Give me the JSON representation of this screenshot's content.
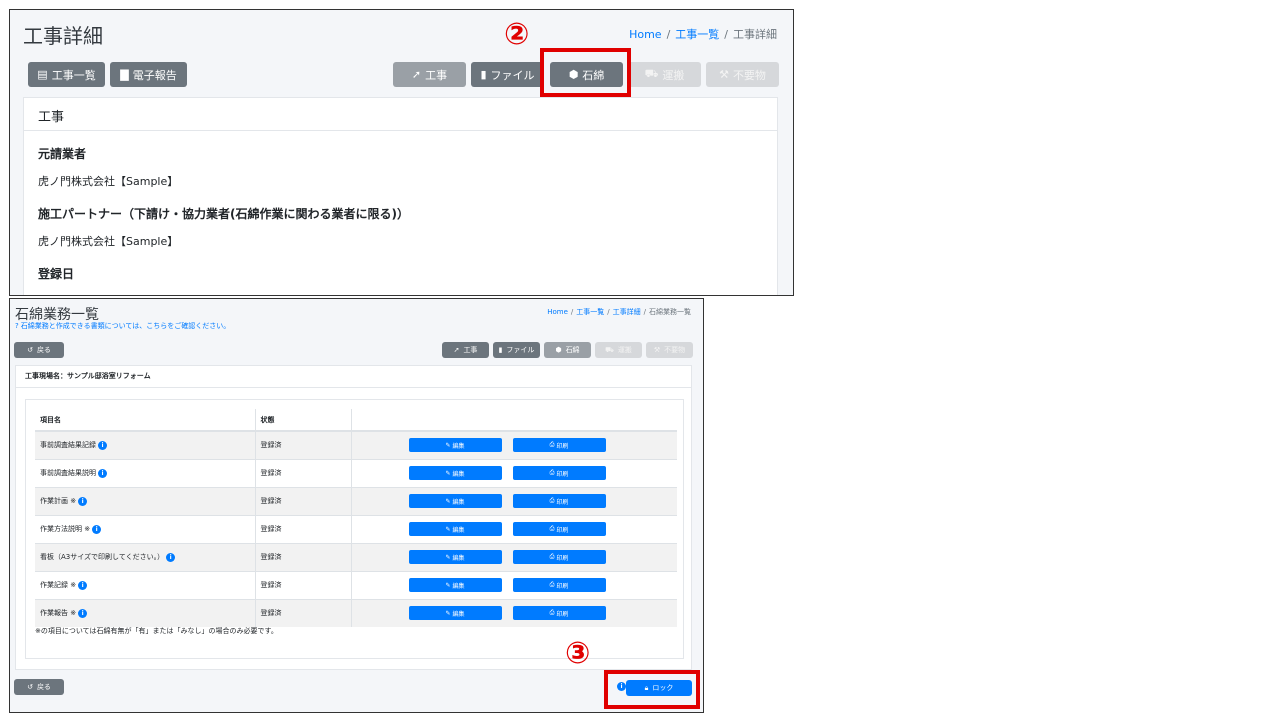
{
  "panel1": {
    "title": "工事詳細",
    "breadcrumb": {
      "home": "Home",
      "list": "工事一覧",
      "current": "工事詳細"
    },
    "left_buttons": {
      "list": "工事一覧",
      "report": "電子報告"
    },
    "tabs": {
      "koji": "工事",
      "file": "ファイル",
      "asbestos": "石綿",
      "transport": "運搬",
      "waste": "不要物"
    },
    "card_header": "工事",
    "fields": [
      {
        "label": "元請業者",
        "value": "虎ノ門株式会社【Sample】"
      },
      {
        "label": "施工パートナー（下請け・協力業者(石綿作業に関わる業者に限る)）",
        "value": "虎ノ門株式会社【Sample】"
      },
      {
        "label": "登録日",
        "value": ""
      }
    ],
    "marker": "②"
  },
  "panel2": {
    "title": "石綿業務一覧",
    "subtitle": "石綿業務と作成できる書類については、こちらをご確認ください。",
    "breadcrumb": {
      "home": "Home",
      "list": "工事一覧",
      "detail": "工事詳細",
      "current": "石綿業務一覧"
    },
    "back_label": "戻る",
    "tabs": {
      "koji": "工事",
      "file": "ファイル",
      "asbestos": "石綿",
      "transport": "運搬",
      "waste": "不要物"
    },
    "site_name": "工事現場名：サンプル邸浴室リフォーム",
    "table": {
      "headers": [
        "項目名",
        "状態",
        ""
      ],
      "rows": [
        {
          "name": "事前調査結果記録",
          "status": "登録済"
        },
        {
          "name": "事前調査結果説明",
          "status": "登録済"
        },
        {
          "name": "作業計画 ※",
          "status": "登録済"
        },
        {
          "name": "作業方法説明 ※",
          "status": "登録済"
        },
        {
          "name": "看板（A3サイズで印刷してください。）",
          "status": "登録済"
        },
        {
          "name": "作業記録 ※",
          "status": "登録済"
        },
        {
          "name": "作業報告 ※",
          "status": "登録済"
        }
      ],
      "edit_label": "編集",
      "print_label": "印刷"
    },
    "note": "※の項目については石綿有無が「有」または「みなし」の場合のみ必要です。",
    "lock_label": "ロック",
    "marker": "③"
  },
  "colors": {
    "primary": "#007bff",
    "secondary": "#6c757d",
    "highlight": "#e00000"
  }
}
